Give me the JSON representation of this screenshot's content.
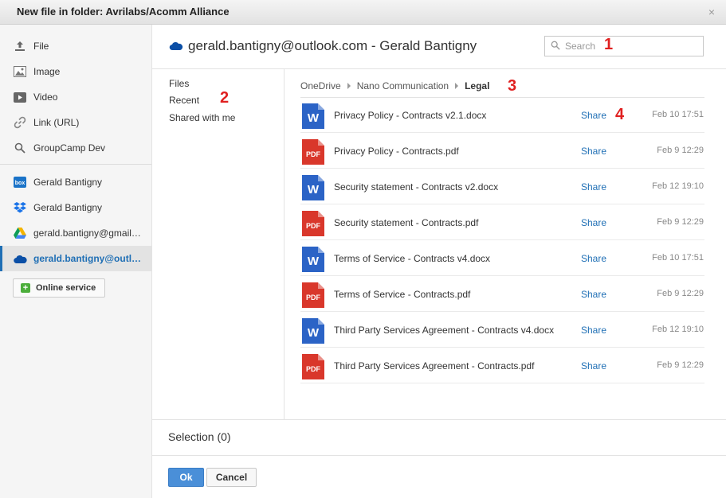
{
  "window": {
    "title": "New file in folder: Avrilabs/Acomm Alliance",
    "close_glyph": "×"
  },
  "sidebar": {
    "sources": [
      {
        "label": "File",
        "icon": "upload-icon"
      },
      {
        "label": "Image",
        "icon": "image-icon"
      },
      {
        "label": "Video",
        "icon": "video-icon"
      },
      {
        "label": "Link (URL)",
        "icon": "link-icon"
      },
      {
        "label": "GroupCamp Dev",
        "icon": "search-icon"
      }
    ],
    "accounts": [
      {
        "label": "Gerald Bantigny",
        "icon": "box-icon"
      },
      {
        "label": "Gerald Bantigny",
        "icon": "dropbox-icon"
      },
      {
        "label": "gerald.bantigny@gmail.com",
        "icon": "google-drive-icon"
      },
      {
        "label": "gerald.bantigny@outlook.com",
        "icon": "onedrive-icon",
        "active": true
      }
    ],
    "online_service_label": "Online service"
  },
  "header": {
    "account_title": "gerald.bantigny@outlook.com - Gerald Bantigny"
  },
  "search": {
    "placeholder": "Search"
  },
  "nav": {
    "files": "Files",
    "recent": "Recent",
    "shared": "Shared with me"
  },
  "breadcrumb": {
    "items": [
      "OneDrive",
      "Nano Communication"
    ],
    "current": "Legal"
  },
  "files": [
    {
      "name": "Privacy Policy - Contracts v2.1.docx",
      "type": "word",
      "share": "Share",
      "date": "Feb 10 17:51"
    },
    {
      "name": "Privacy Policy - Contracts.pdf",
      "type": "pdf",
      "share": "Share",
      "date": "Feb 9 12:29"
    },
    {
      "name": "Security statement - Contracts v2.docx",
      "type": "word",
      "share": "Share",
      "date": "Feb 12 19:10"
    },
    {
      "name": "Security statement - Contracts.pdf",
      "type": "pdf",
      "share": "Share",
      "date": "Feb 9 12:29"
    },
    {
      "name": "Terms of Service - Contracts v4.docx",
      "type": "word",
      "share": "Share",
      "date": "Feb 10 17:51"
    },
    {
      "name": "Terms of Service - Contracts.pdf",
      "type": "pdf",
      "share": "Share",
      "date": "Feb 9 12:29"
    },
    {
      "name": "Third Party Services Agreement - Contracts v4.docx",
      "type": "word",
      "share": "Share",
      "date": "Feb 12 19:10"
    },
    {
      "name": "Third Party Services Agreement - Contracts.pdf",
      "type": "pdf",
      "share": "Share",
      "date": "Feb 9 12:29"
    }
  ],
  "icon_text": {
    "word": "W",
    "pdf": "PDF",
    "box": "box"
  },
  "annotations": [
    "1",
    "2",
    "3",
    "4"
  ],
  "footer": {
    "selection": "Selection (0)",
    "ok": "Ok",
    "cancel": "Cancel"
  },
  "colors": {
    "accent": "#1f6fb5",
    "word": "#2b63c6",
    "pdf": "#d9372b",
    "ok": "#4a8fd8",
    "annotation": "#e02020"
  }
}
